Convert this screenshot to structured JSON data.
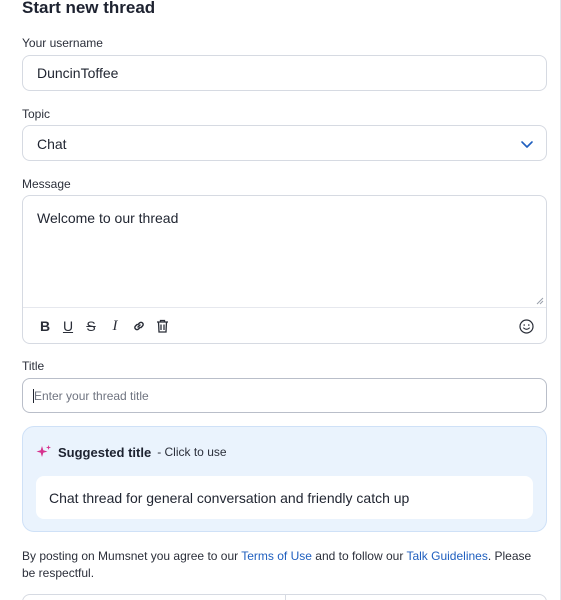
{
  "form": {
    "heading": "Start new thread",
    "username_label": "Your username",
    "username_value": "DuncinToffee",
    "topic_label": "Topic",
    "topic_value": "Chat",
    "message_label": "Message",
    "message_value": "Welcome to our thread",
    "toolbar": {
      "bold": "B",
      "underline": "U",
      "strikethrough": "S",
      "italic": "I"
    },
    "title_label": "Title",
    "title_placeholder": "Enter your thread title"
  },
  "suggestion": {
    "label": "Suggested title",
    "hint": "- Click to use",
    "title": "Chat thread for general conversation and friendly catch up"
  },
  "terms": {
    "prefix": "By posting on Mumsnet you agree to our ",
    "terms_link": "Terms of Use",
    "middle": " and to follow our ",
    "guidelines_link": "Talk Guidelines",
    "suffix": ". Please be respectful."
  },
  "icons": {
    "topic_dropdown": "chevron-down-icon",
    "link": "link-icon",
    "delete": "trash-icon",
    "emoji": "smiley-icon",
    "sparkle": "sparkle-icon"
  },
  "colors": {
    "link": "#1f5fbf",
    "suggestion_bg": "#eaf3fd",
    "sparkle": "#d6338e",
    "chevron": "#1f5fbf"
  }
}
